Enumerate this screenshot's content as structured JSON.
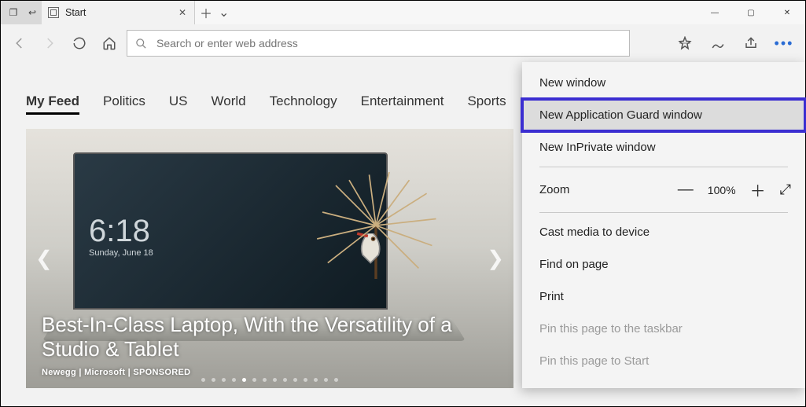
{
  "window": {
    "tab_title": "Start",
    "new_tab_tooltip": "New tab"
  },
  "toolbar": {
    "address_placeholder": "Search or enter web address"
  },
  "feed_nav": [
    "My Feed",
    "Politics",
    "US",
    "World",
    "Technology",
    "Entertainment",
    "Sports"
  ],
  "feed_nav_active": 0,
  "hero": {
    "screen_time": "6:18",
    "screen_date": "Sunday, June 18",
    "title": "Best-In-Class Laptop, With the Versatility of a Studio & Tablet",
    "source": "Newegg | Microsoft | SPONSORED",
    "dot_count": 14,
    "dot_active": 4
  },
  "menu": {
    "items": [
      {
        "label": "New window",
        "kind": "item"
      },
      {
        "label": "New Application Guard window",
        "kind": "highlight"
      },
      {
        "label": "New InPrivate window",
        "kind": "item"
      },
      {
        "kind": "sep"
      },
      {
        "kind": "zoom",
        "label": "Zoom",
        "value": "100%"
      },
      {
        "kind": "sep"
      },
      {
        "label": "Cast media to device",
        "kind": "item"
      },
      {
        "label": "Find on page",
        "kind": "item"
      },
      {
        "label": "Print",
        "kind": "item"
      },
      {
        "label": "Pin this page to the taskbar",
        "kind": "disabled"
      },
      {
        "label": "Pin this page to Start",
        "kind": "disabled"
      }
    ]
  }
}
